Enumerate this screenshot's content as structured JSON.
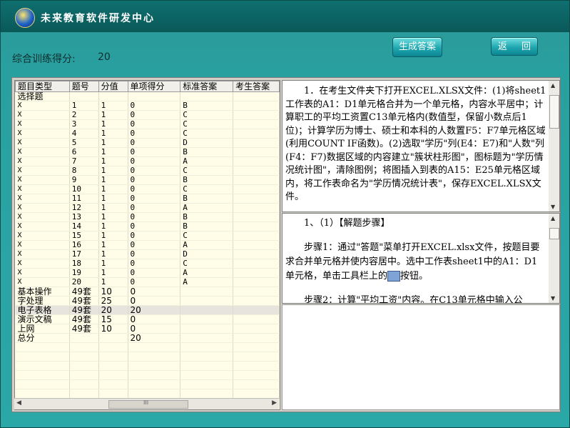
{
  "app": {
    "title": "未来教育软件研发中心",
    "logo_text": "未来教育"
  },
  "score": {
    "label": "综合训练得分:",
    "value": "20"
  },
  "buttons": {
    "generate": "生成答案",
    "back": "返 回"
  },
  "table": {
    "headers": [
      "题目类型",
      "题号",
      "分值",
      "单项得分",
      "标准答案",
      "考生答案"
    ],
    "group_choice": "选择题",
    "choice_rows": [
      {
        "mark": "X",
        "no": "1",
        "pts": "1",
        "score": "0",
        "ans": "B"
      },
      {
        "mark": "X",
        "no": "2",
        "pts": "1",
        "score": "0",
        "ans": "C"
      },
      {
        "mark": "X",
        "no": "3",
        "pts": "1",
        "score": "0",
        "ans": "C"
      },
      {
        "mark": "X",
        "no": "4",
        "pts": "1",
        "score": "0",
        "ans": "C"
      },
      {
        "mark": "X",
        "no": "5",
        "pts": "1",
        "score": "0",
        "ans": "D"
      },
      {
        "mark": "X",
        "no": "6",
        "pts": "1",
        "score": "0",
        "ans": "B"
      },
      {
        "mark": "X",
        "no": "7",
        "pts": "1",
        "score": "0",
        "ans": "A"
      },
      {
        "mark": "X",
        "no": "8",
        "pts": "1",
        "score": "0",
        "ans": "C"
      },
      {
        "mark": "X",
        "no": "9",
        "pts": "1",
        "score": "0",
        "ans": "B"
      },
      {
        "mark": "X",
        "no": "10",
        "pts": "1",
        "score": "0",
        "ans": "C"
      },
      {
        "mark": "X",
        "no": "11",
        "pts": "1",
        "score": "0",
        "ans": "B"
      },
      {
        "mark": "X",
        "no": "12",
        "pts": "1",
        "score": "0",
        "ans": "A"
      },
      {
        "mark": "X",
        "no": "13",
        "pts": "1",
        "score": "0",
        "ans": "B"
      },
      {
        "mark": "X",
        "no": "14",
        "pts": "1",
        "score": "0",
        "ans": "B"
      },
      {
        "mark": "X",
        "no": "15",
        "pts": "1",
        "score": "0",
        "ans": "C"
      },
      {
        "mark": "X",
        "no": "16",
        "pts": "1",
        "score": "0",
        "ans": "A"
      },
      {
        "mark": "X",
        "no": "17",
        "pts": "1",
        "score": "0",
        "ans": "D"
      },
      {
        "mark": "X",
        "no": "18",
        "pts": "1",
        "score": "0",
        "ans": "C"
      },
      {
        "mark": "X",
        "no": "19",
        "pts": "1",
        "score": "0",
        "ans": "A"
      },
      {
        "mark": "X",
        "no": "20",
        "pts": "1",
        "score": "0",
        "ans": "A"
      }
    ],
    "summary_rows": [
      {
        "type": "基本操作",
        "no": "49套",
        "pts": "10",
        "score": "0"
      },
      {
        "type": "字处理",
        "no": "49套",
        "pts": "25",
        "score": "0"
      },
      {
        "type": "电子表格",
        "no": "49套",
        "pts": "20",
        "score": "20",
        "selected": true
      },
      {
        "type": "演示文稿",
        "no": "49套",
        "pts": "15",
        "score": "0"
      },
      {
        "type": "上网",
        "no": "49套",
        "pts": "10",
        "score": "0"
      },
      {
        "type": "总分",
        "no": "",
        "pts": "",
        "score": "20"
      }
    ],
    "scroll_grip": "III"
  },
  "question": {
    "text": "　　1．在考生文件夹下打开EXCEL.XLSX文件：(1)将sheet1工作表的A1：D1单元格合并为一个单元格，内容水平居中；计算职工的平均工资置C13单元格内(数值型，保留小数点后1位)；计算学历为博士、硕士和本科的人数置F5：F7单元格区域(利用COUNT IF函数)。(2)选取\"学历\"列(E4：E7)和\"人数\"列(F4：F7)数据区域的内容建立\"簇状柱形图\"，图标题为\"学历情况统计图\"，清除图例；将图插入到表的A15：E25单元格区域内，将工作表命名为\"学历情况统计表\"，保存EXCEL.XLSX文件。"
  },
  "solution": {
    "heading": "　　1、（1）【解题步骤】",
    "step1_a": "　　步骤1：通过\"答题\"菜单打开EXCEL.xlsx文件，按题目要求合并单元格并使内容居中。选中工作表sheet1中的A1：D1单元格，单击工具栏上的",
    "step1_b": "按钮。",
    "step2": "　　步骤2：计算\"平均工资\"内容。在C13单元格中输入公"
  }
}
